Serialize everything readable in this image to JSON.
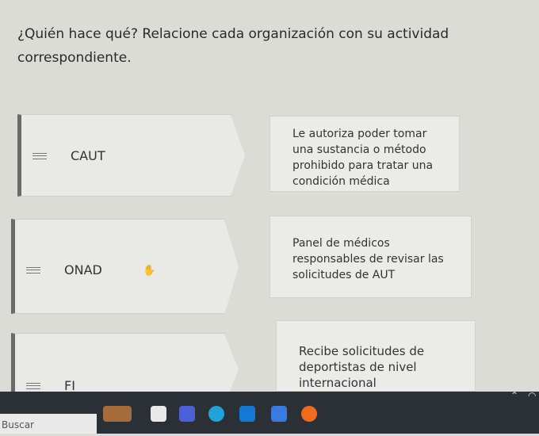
{
  "question": "¿Quién hace qué? Relacione cada organización con su actividad correspondiente.",
  "items": [
    {
      "label": "CAUT",
      "description": "Le autoriza poder tomar una sustancia o método prohibido para tratar una condición médica"
    },
    {
      "label": "ONAD",
      "description": "Panel de médicos responsables de revisar las solicitudes de AUT"
    },
    {
      "label": "FI",
      "description": "Recibe solicitudes de deportistas de nivel internacional"
    }
  ],
  "taskbar": {
    "search_label": "Buscar",
    "icons": [
      "widget-icon",
      "file-explorer-icon",
      "media-icon",
      "edge-icon",
      "outlook-icon",
      "store-icon",
      "firefox-icon"
    ],
    "tray": [
      "chevron-up-icon",
      "wifi-icon"
    ]
  }
}
